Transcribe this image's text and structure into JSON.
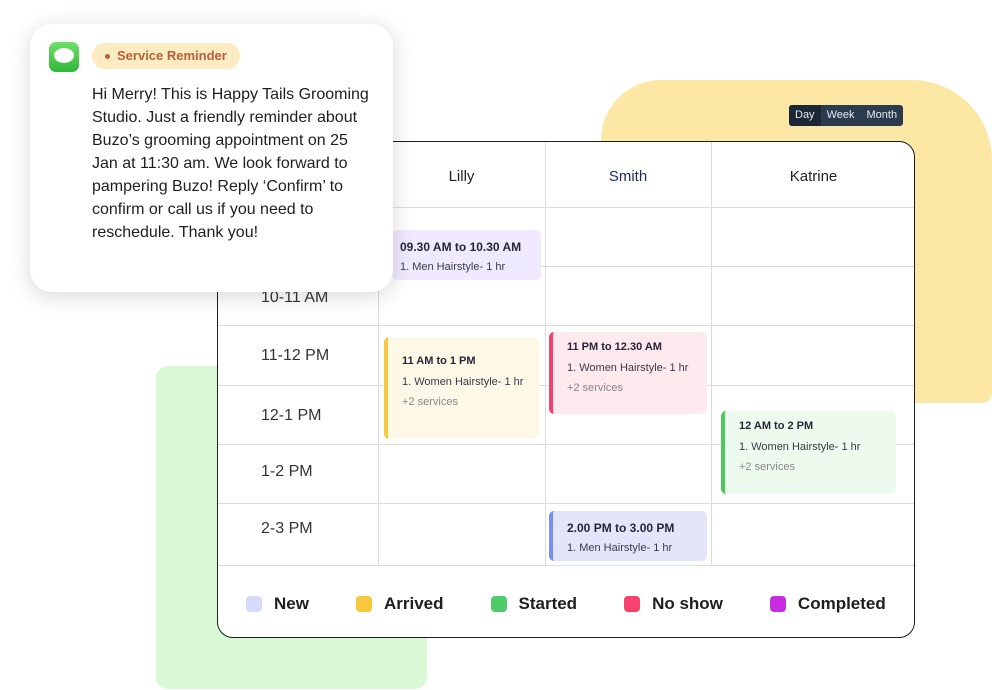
{
  "view_switch": {
    "options": [
      "Day",
      "Week",
      "Month"
    ],
    "selected": "Day"
  },
  "columns": [
    "Lilly",
    "Smith",
    "Katrine"
  ],
  "time_slots": [
    "10-11 AM",
    "11-12 PM",
    "12-1 PM",
    "1-2 PM",
    "2-3 PM"
  ],
  "appointments": [
    {
      "staff": "Lilly",
      "time": "09.30 AM to 10.30 AM",
      "service": "1. Men Hairstyle- 1 hr",
      "more": "",
      "status": "New",
      "bg": "#efeafd",
      "accent": ""
    },
    {
      "staff": "Lilly",
      "time": "11 AM to 1 PM",
      "service": "1. Women Hairstyle- 1 hr",
      "more": "+2 services",
      "status": "Arrived",
      "bg": "#fef8e6",
      "accent": "#f6c945"
    },
    {
      "staff": "Smith",
      "time": "11 PM to 12.30 AM",
      "service": "1. Women Hairstyle- 1 hr",
      "more": "+2 services",
      "status": "No show",
      "bg": "#fde9ee",
      "accent": "#f2426b"
    },
    {
      "staff": "Katrine",
      "time": "12 AM to 2 PM",
      "service": "1. Women Hairstyle- 1 hr",
      "more": "+2 services",
      "status": "Started",
      "bg": "#edfbee",
      "accent": "#4fc760"
    },
    {
      "staff": "Smith",
      "time": "2.00 PM to 3.00 PM",
      "service": "1. Men Hairstyle- 1 hr",
      "more": "",
      "status": "New",
      "bg": "#e3e6fb",
      "accent": "#7c8ef0"
    }
  ],
  "legend": [
    {
      "label": "New",
      "color": "#d5dcfb"
    },
    {
      "label": "Arrived",
      "color": "#f8c73c"
    },
    {
      "label": "Started",
      "color": "#4fcc6a"
    },
    {
      "label": "No show",
      "color": "#f7426e"
    },
    {
      "label": "Completed",
      "color": "#c72ce0"
    }
  ],
  "reminder": {
    "icon": "messages-icon",
    "badge": "Service Reminder",
    "message": "Hi Merry! This is Happy Tails Grooming Studio. Just a friendly reminder about Buzo’s grooming appointment on 25 Jan at 11:30 am. We look forward to pampering Buzo! Reply ‘Confirm’ to confirm or call us if you need to reschedule. Thank you!"
  }
}
